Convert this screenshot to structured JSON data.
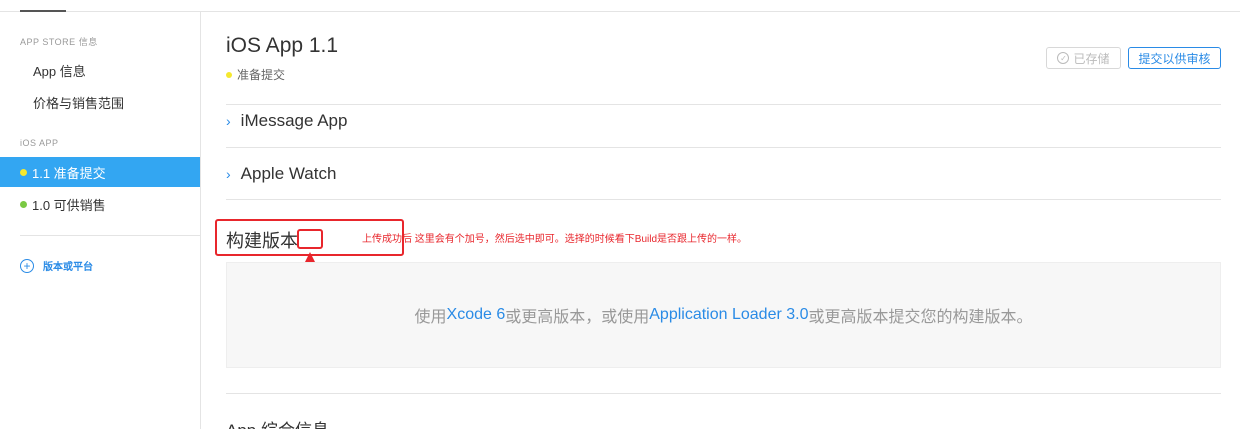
{
  "sidebar": {
    "store_heading": "APP STORE 信息",
    "store_items": [
      "App 信息",
      "价格与销售范围"
    ],
    "ios_heading": "iOS APP",
    "versions": [
      {
        "label": "1.1 准备提交",
        "status_color": "#f5e82e",
        "active": true
      },
      {
        "label": "1.0 可供销售",
        "status_color": "#7ac943",
        "active": false
      }
    ],
    "add_label": "版本或平台"
  },
  "header": {
    "title": "iOS App 1.1",
    "status": "准备提交",
    "saved_label": "已存储",
    "submit_label": "提交以供审核"
  },
  "sections": {
    "imessage": "iMessage App",
    "watch": "Apple Watch"
  },
  "build": {
    "title": "构建版本",
    "annotation": "上传成功后  这里会有个加号，然后选中即可。选择的时候看下Build是否跟上传的一样。",
    "message": {
      "part1": "使用 ",
      "link1": "Xcode 6",
      "part2": " 或更高版本，或使用 ",
      "link2": "Application Loader 3.0",
      "part3": " 或更高版本提交您的构建版本。"
    }
  },
  "next_section": "App 综合信息",
  "colors": {
    "accent": "#2a8be6",
    "active_bg": "#33a6f2",
    "annotation_red": "#e8262c"
  }
}
